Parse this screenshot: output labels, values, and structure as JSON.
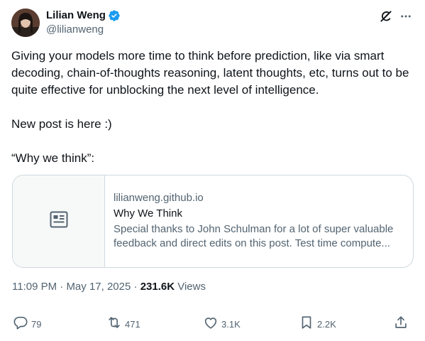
{
  "author": {
    "display_name": "Lilian Weng",
    "handle": "@lilianweng",
    "verified_color": "#1d9bf0"
  },
  "tweet": {
    "text": "Giving your models more time to think before prediction, like via smart decoding, chain-of-thoughts reasoning, latent thoughts, etc, turns out to be quite effective for unblocking the next level of intelligence.\n\nNew post is here :)\n\n“Why we think”:"
  },
  "card": {
    "domain": "lilianweng.github.io",
    "title": "Why We Think",
    "description": "Special thanks to John Schulman for a lot of super valuable feedback and direct edits on this post. Test time compute...",
    "thumb_icon": "article-icon"
  },
  "meta": {
    "time": "11:09 PM",
    "date": "May 17, 2025",
    "views_count": "231.6K",
    "views_label": "Views"
  },
  "actions": {
    "replies": "79",
    "reposts": "471",
    "likes": "3.1K",
    "bookmarks": "2.2K"
  },
  "icons": {
    "top_right": [
      "grok-icon",
      "more-icon"
    ],
    "actions": [
      "reply-icon",
      "repost-icon",
      "like-icon",
      "bookmark-icon",
      "share-icon"
    ]
  }
}
